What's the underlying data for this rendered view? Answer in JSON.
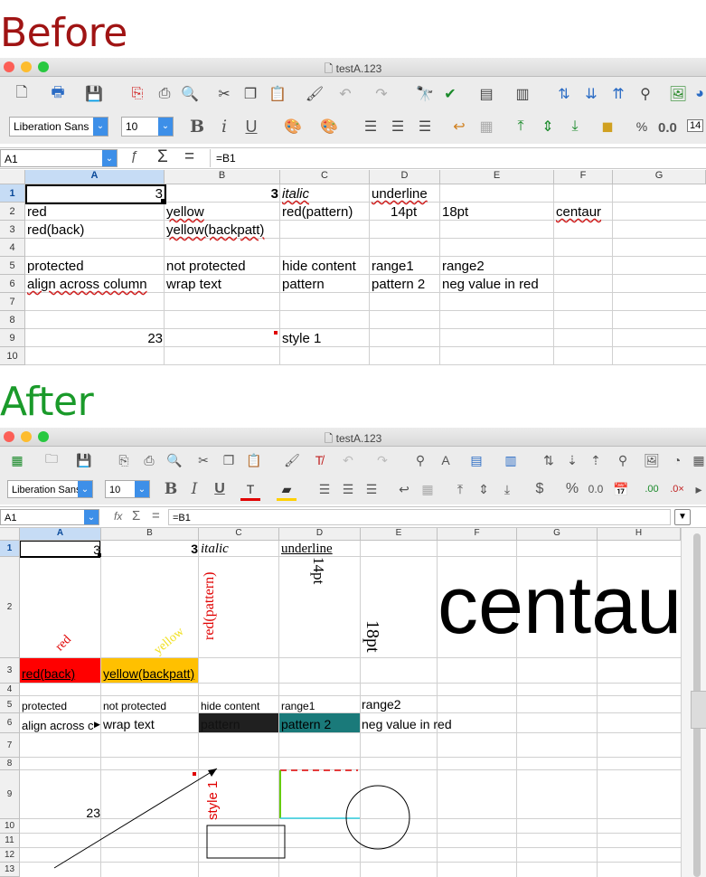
{
  "headings": {
    "before": "Before",
    "after": "After",
    "before_color": "#a01414",
    "after_color": "#1a9a2a"
  },
  "window": {
    "title": "testA.123"
  },
  "before": {
    "font_name": "Liberation Sans",
    "font_size": "10",
    "cell_ref": "A1",
    "formula": "=B1",
    "number_format": "0.0",
    "toolbar_badge": "14",
    "columns": [
      "A",
      "B",
      "C",
      "D",
      "E",
      "F",
      "G"
    ],
    "rows": [
      "1",
      "2",
      "3",
      "4",
      "5",
      "6",
      "7",
      "8",
      "9",
      "10"
    ],
    "cells": {
      "a1": "3",
      "b1": "3",
      "c1": "italic",
      "d1": "underline",
      "a2": "red",
      "b2": "yellow",
      "c2": "red(pattern)",
      "d2": "14pt",
      "e2": "18pt",
      "f2": "centaur",
      "a3": "red(back)",
      "b3": "yellow(backpatt)",
      "a5": "protected",
      "b5": "not protected",
      "c5": "hide content",
      "d5": "range1",
      "e5": "range2",
      "a6": "align across column",
      "b6": "wrap text",
      "c6": "pattern",
      "d6": "pattern 2",
      "e6": "neg value in red",
      "a9": "23",
      "c9": "style 1"
    }
  },
  "after": {
    "font_name": "Liberation Sans",
    "font_size": "10",
    "cell_ref": "A1",
    "formula": "=B1",
    "fx": "fx",
    "sigma": "Σ",
    "equals": "=",
    "currency": "$",
    "percent": "%",
    "decimal": "0.0",
    "columns": [
      "A",
      "B",
      "C",
      "D",
      "E",
      "F",
      "G",
      "H"
    ],
    "rows": [
      "1",
      "2",
      "3",
      "4",
      "5",
      "6",
      "7",
      "8",
      "9",
      "10",
      "11",
      "12",
      "13"
    ],
    "cells": {
      "a1": "3",
      "b1": "3",
      "c1": "italic",
      "d1": "underline",
      "a2": "red",
      "b2": "yellow",
      "c2": "red(pattern)",
      "d2": "14pt",
      "e2": "18pt",
      "f2": "centau",
      "a3": "red(back)",
      "b3": "yellow(backpatt)",
      "a5": "protected",
      "b5": "not protected",
      "c5": "hide content",
      "d5": "range1",
      "e5": "range2",
      "a6": "align across c",
      "b6": "wrap text",
      "c6": "pattern",
      "d6": "pattern 2",
      "e6": "neg value in red",
      "a9": "23",
      "c9": "style 1"
    }
  },
  "colors": {
    "red_back": "#ff0000",
    "yellow_back": "#ffc000",
    "pattern": "#202020",
    "pattern2": "#1a7a7a",
    "accent": "#3d8fe8"
  }
}
